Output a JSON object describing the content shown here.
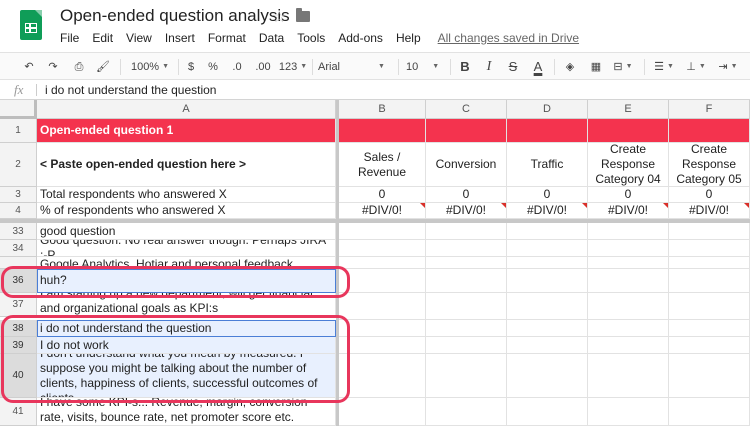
{
  "app": {
    "title": "Open-ended question analysis",
    "save_status": "All changes saved in Drive",
    "menu": [
      "File",
      "Edit",
      "View",
      "Insert",
      "Format",
      "Data",
      "Tools",
      "Add-ons",
      "Help"
    ]
  },
  "toolbar": {
    "zoom": "100%",
    "currency": "$",
    "percent": "%",
    "dec_decrease": ".0",
    "dec_increase": ".00",
    "more_formats": "123",
    "font": "Arial",
    "font_size": "10",
    "bold": "B",
    "italic": "I",
    "strike": "S",
    "text_color": "A"
  },
  "formula_bar": {
    "fx": "fx",
    "value": "i do not understand the question"
  },
  "grid": {
    "columns": [
      "A",
      "B",
      "C",
      "D",
      "E",
      "F"
    ],
    "rows": {
      "r1": {
        "num": "1",
        "a": "Open-ended question 1"
      },
      "r2": {
        "num": "2",
        "a": "< Paste open-ended question here >",
        "b": "Sales / Revenue",
        "c": "Conversion",
        "d": "Traffic",
        "e": "Create Response Category 04",
        "f": "Create Response Category 05"
      },
      "r3": {
        "num": "3",
        "a": "Total respondents who answered X",
        "b": "0",
        "c": "0",
        "d": "0",
        "e": "0",
        "f": "0"
      },
      "r4": {
        "num": "4",
        "a": "% of respondents who answered X",
        "b": "#DIV/0!",
        "c": "#DIV/0!",
        "d": "#DIV/0!",
        "e": "#DIV/0!",
        "f": "#DIV/0!"
      },
      "r33": {
        "num": "33",
        "a": "good question"
      },
      "r34": {
        "num": "34",
        "a": "Good question. No real answer though. Perhaps JIRA :-P"
      },
      "r35": {
        "num": "35",
        "a": "Google Analytics, Hotjar and personal feedback"
      },
      "r36": {
        "num": "36",
        "a": "huh?"
      },
      "r37": {
        "num": "37",
        "a": "I am starting up a new department, will get financial and organizational goals as KPI:s"
      },
      "r38": {
        "num": "38",
        "a": "i do not understand the question"
      },
      "r39": {
        "num": "39",
        "a": "I do not work"
      },
      "r40": {
        "num": "40",
        "a": "I don't understand what you mean by measured. I suppose you might be talking about the number of clients, happiness of clients, successful outcomes of clients."
      },
      "r41": {
        "num": "41",
        "a": "I have some KPI-s... Revenue, margin, conversion rate, visits, bounce rate, net promoter score etc."
      }
    }
  },
  "colors": {
    "header_red": "#f4334e",
    "annotation": "#e8365c",
    "selection_blue": "#4a7ed6",
    "sheets_green": "#0f9d58"
  }
}
